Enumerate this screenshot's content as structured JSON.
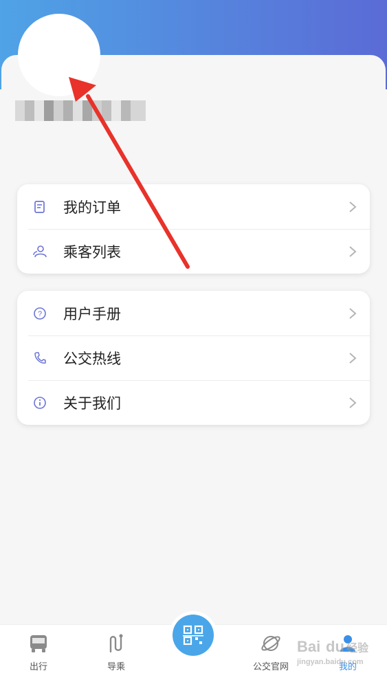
{
  "profile": {
    "avatar_icon": "avatar-placeholder",
    "username_blurred": true
  },
  "menu_group1": [
    {
      "label": "我的订单",
      "icon": "order-icon"
    },
    {
      "label": "乘客列表",
      "icon": "passengers-icon"
    }
  ],
  "menu_group2": [
    {
      "label": "用户手册",
      "icon": "help-icon"
    },
    {
      "label": "公交热线",
      "icon": "phone-icon"
    },
    {
      "label": "关于我们",
      "icon": "info-icon"
    }
  ],
  "tabbar": [
    {
      "label": "出行",
      "icon": "bus-icon"
    },
    {
      "label": "导乘",
      "icon": "route-icon"
    },
    {
      "label": "",
      "icon": "qr-code-icon"
    },
    {
      "label": "公交官网",
      "icon": "planet-icon"
    },
    {
      "label": "我的",
      "icon": "user-icon",
      "active": true
    }
  ],
  "colors": {
    "header_gradient_start": "#4fa3e6",
    "header_gradient_end": "#5b6bd6",
    "accent": "#3a8fe6",
    "annotation_arrow": "#e8322a"
  }
}
